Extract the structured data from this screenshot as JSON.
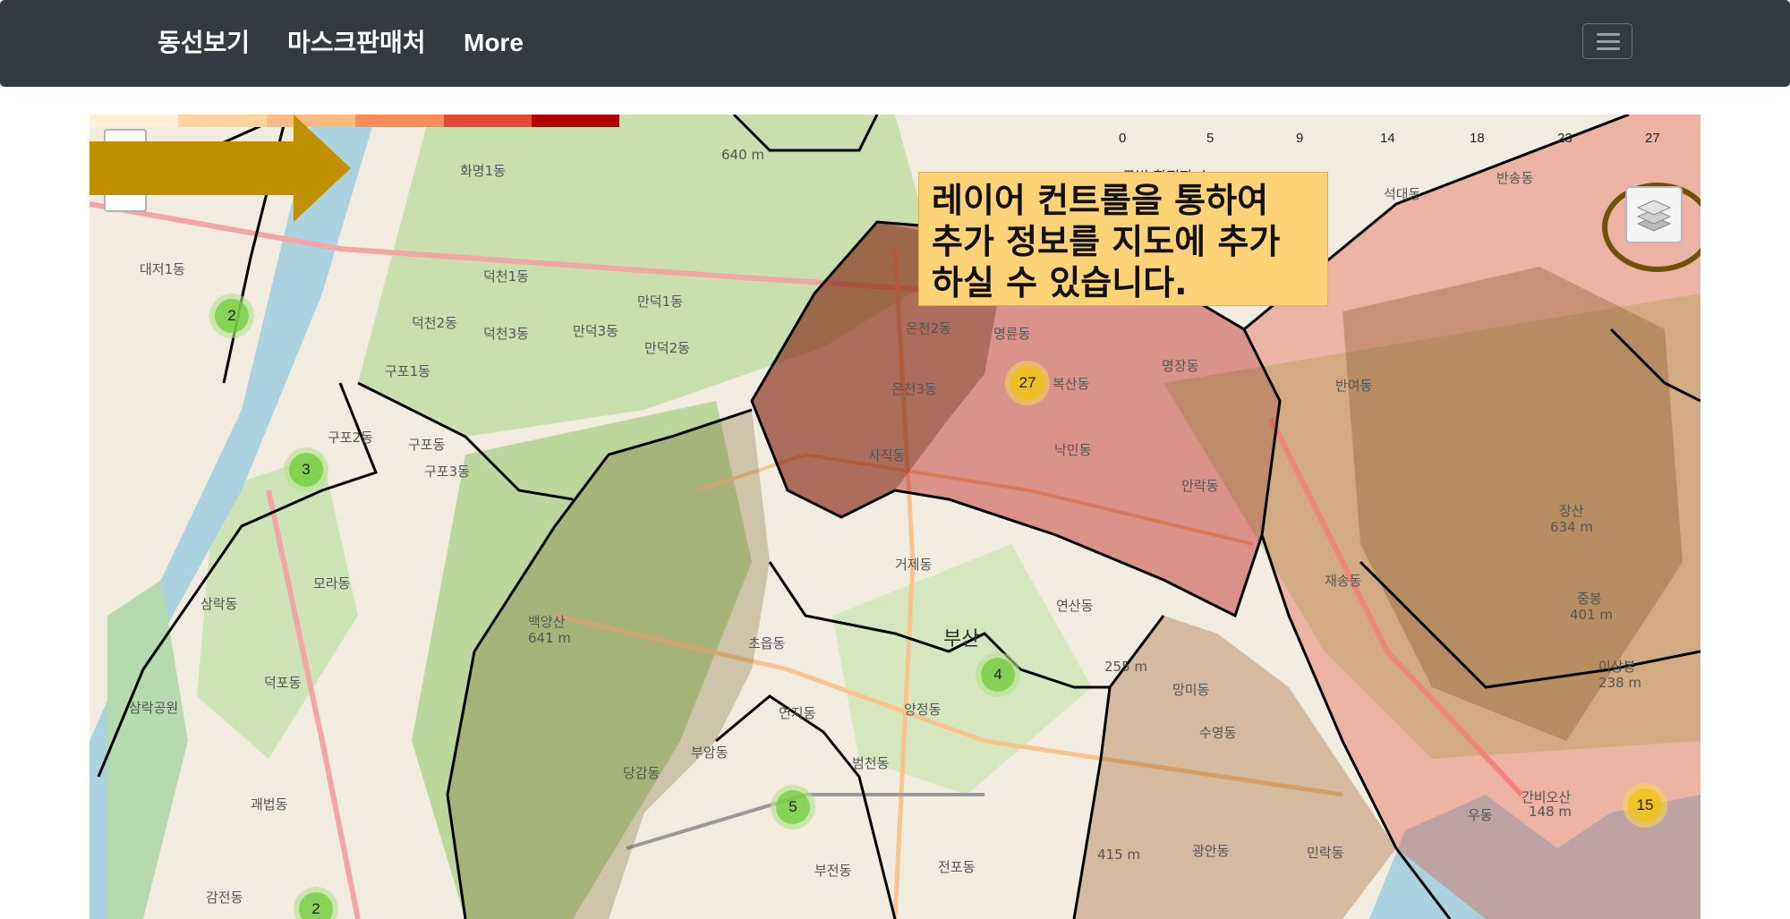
{
  "navbar": {
    "items": [
      "동선보기",
      "마스크판매처",
      "More"
    ],
    "menu_icon": "hamburger-menu-icon"
  },
  "map": {
    "zoom_in_label": "+",
    "zoom_out_label": "−",
    "legend": {
      "ticks": [
        "0",
        "5",
        "9",
        "14",
        "18",
        "23",
        "27"
      ],
      "caption": "구별 확진자 수",
      "colors": [
        "#fef0d9",
        "#fdd49e",
        "#fdbb84",
        "#fc8d59",
        "#e34a33",
        "#b30000"
      ]
    },
    "callout": {
      "lines": [
        "레이어 컨트롤을 통하여",
        "추가 정보를 지도에 추가",
        "하실 수 있습니다."
      ],
      "arrow_color": "#c09000"
    },
    "layers_icon": "layers-icon",
    "clusters": [
      {
        "count": "2",
        "color": "green"
      },
      {
        "count": "3",
        "color": "green"
      },
      {
        "count": "27",
        "color": "yellow"
      },
      {
        "count": "4",
        "color": "green"
      },
      {
        "count": "5",
        "color": "green"
      },
      {
        "count": "2",
        "color": "green"
      },
      {
        "count": "15",
        "color": "yellow"
      }
    ],
    "place_labels": [
      "화명1동",
      "대저1동",
      "덕천1동",
      "덕천2동",
      "덕천3동",
      "만덕1동",
      "만덕3동",
      "만덕2동",
      "구포1동",
      "구포2동",
      "구포동",
      "구포3동",
      "모라동",
      "삼락동",
      "덕포동",
      "삼락공원",
      "괘법동",
      "감전동",
      "온천2동",
      "온천3동",
      "명륜동",
      "명장동",
      "복산동",
      "사직동",
      "낙민동",
      "안락동",
      "반여동",
      "석대동",
      "반송동",
      "재송동",
      "거제동",
      "연산동",
      "초읍동",
      "연지동",
      "양정동",
      "부암동",
      "당감동",
      "범천동",
      "부전동",
      "전포동",
      "망미동",
      "수영동",
      "광안동",
      "민락동",
      "우동",
      "부산",
      "장산",
      "634 m",
      "중봉",
      "401 m",
      "이상봉",
      "238 m",
      "간비오산",
      "148 m",
      "백양산",
      "641 m",
      "640 m",
      "255 m",
      "415 m"
    ]
  }
}
